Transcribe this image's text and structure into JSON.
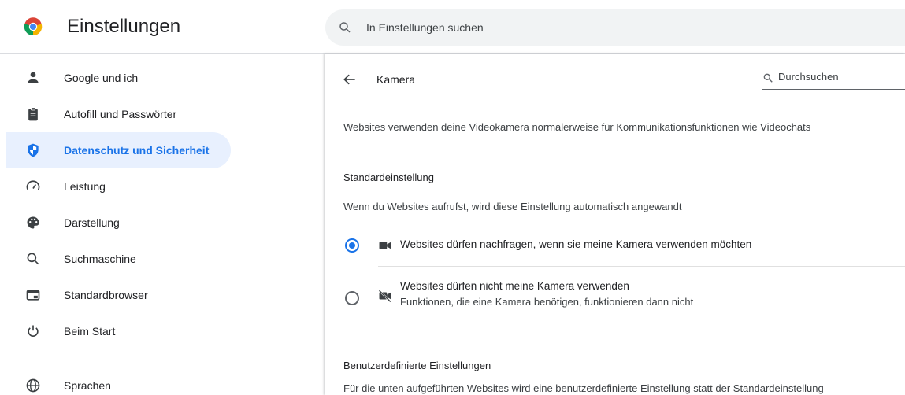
{
  "app": {
    "title": "Einstellungen"
  },
  "search": {
    "placeholder": "In Einstellungen suchen"
  },
  "sidebar": {
    "items": [
      {
        "label": "Google und ich",
        "icon": "person-icon"
      },
      {
        "label": "Autofill und Passwörter",
        "icon": "clipboard-icon"
      },
      {
        "label": "Datenschutz und Sicherheit",
        "icon": "shield-icon",
        "active": true
      },
      {
        "label": "Leistung",
        "icon": "speedometer-icon"
      },
      {
        "label": "Darstellung",
        "icon": "palette-icon"
      },
      {
        "label": "Suchmaschine",
        "icon": "search-icon"
      },
      {
        "label": "Standardbrowser",
        "icon": "browser-window-icon"
      },
      {
        "label": "Beim Start",
        "icon": "power-icon"
      },
      {
        "label": "Sprachen",
        "icon": "globe-icon"
      }
    ]
  },
  "page": {
    "title": "Kamera",
    "search_placeholder": "Durchsuchen",
    "description": "Websites verwenden deine Videokamera normalerweise für Kommunikationsfunktionen wie Videochats",
    "default_section": {
      "label": "Standardeinstellung",
      "sublabel": "Wenn du Websites aufrufst, wird diese Einstellung automatisch angewandt"
    },
    "options": [
      {
        "label": "Websites dürfen nachfragen, wenn sie meine Kamera verwenden möchten",
        "sublabel": "",
        "checked": true,
        "icon": "videocam-icon"
      },
      {
        "label": "Websites dürfen nicht meine Kamera verwenden",
        "sublabel": "Funktionen, die eine Kamera benötigen, funktionieren dann nicht",
        "checked": false,
        "icon": "videocam-off-icon"
      }
    ],
    "custom_section": {
      "label": "Benutzerdefinierte Einstellungen",
      "sublabel": "Für die unten aufgeführten Websites wird eine benutzerdefinierte Einstellung statt der Standardeinstellung"
    }
  },
  "colors": {
    "accent": "#1a73e8",
    "active_bg": "#e8f0fe",
    "search_bg": "#f1f3f4"
  }
}
